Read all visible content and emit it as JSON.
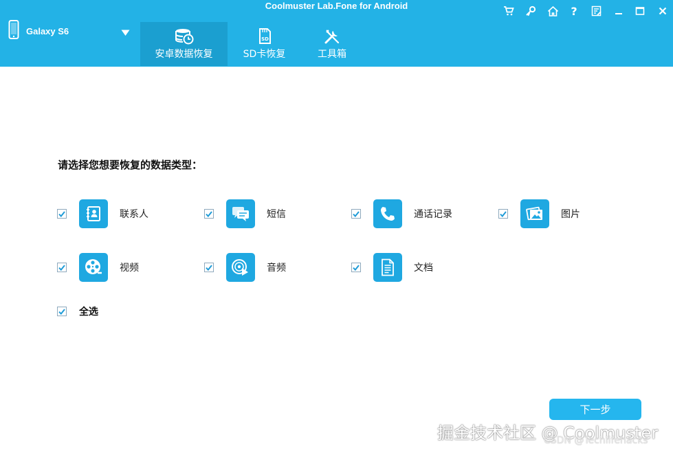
{
  "app": {
    "title": "Coolmuster Lab.Fone for Android"
  },
  "device": {
    "name": "Galaxy S6"
  },
  "tabs": [
    {
      "label": "安卓数据恢复",
      "icon": "database-clock-icon",
      "active": true
    },
    {
      "label": "SD卡恢复",
      "icon": "sd-card-icon",
      "active": false
    },
    {
      "label": "工具箱",
      "icon": "tools-icon",
      "active": false
    }
  ],
  "title_bar_icons": [
    "cart-icon",
    "key-icon",
    "home-icon",
    "help-icon",
    "feedback-icon",
    "minimize-icon",
    "maximize-icon",
    "close-icon"
  ],
  "main": {
    "prompt": "请选择您想要恢复的数据类型：",
    "options": [
      {
        "label": "联系人",
        "icon": "contacts-icon",
        "checked": true
      },
      {
        "label": "短信",
        "icon": "messages-icon",
        "checked": true
      },
      {
        "label": "通话记录",
        "icon": "call-log-icon",
        "checked": true
      },
      {
        "label": "图片",
        "icon": "photos-icon",
        "checked": true
      },
      {
        "label": "视频",
        "icon": "video-icon",
        "checked": true
      },
      {
        "label": "音频",
        "icon": "audio-icon",
        "checked": true
      },
      {
        "label": "文档",
        "icon": "document-icon",
        "checked": true
      }
    ],
    "select_all": {
      "label": "全选",
      "checked": true
    },
    "next_button": "下一步"
  },
  "watermark": {
    "line1": "掘金技术社区 @ Coolmuster",
    "line2": "CSDN @Techlifehacks"
  },
  "colors": {
    "header": "#23b2e6",
    "active_tab": "#1b9fd0",
    "tile": "#1fa8e1",
    "button": "#25b6ee",
    "check": "#1e9bd7"
  }
}
